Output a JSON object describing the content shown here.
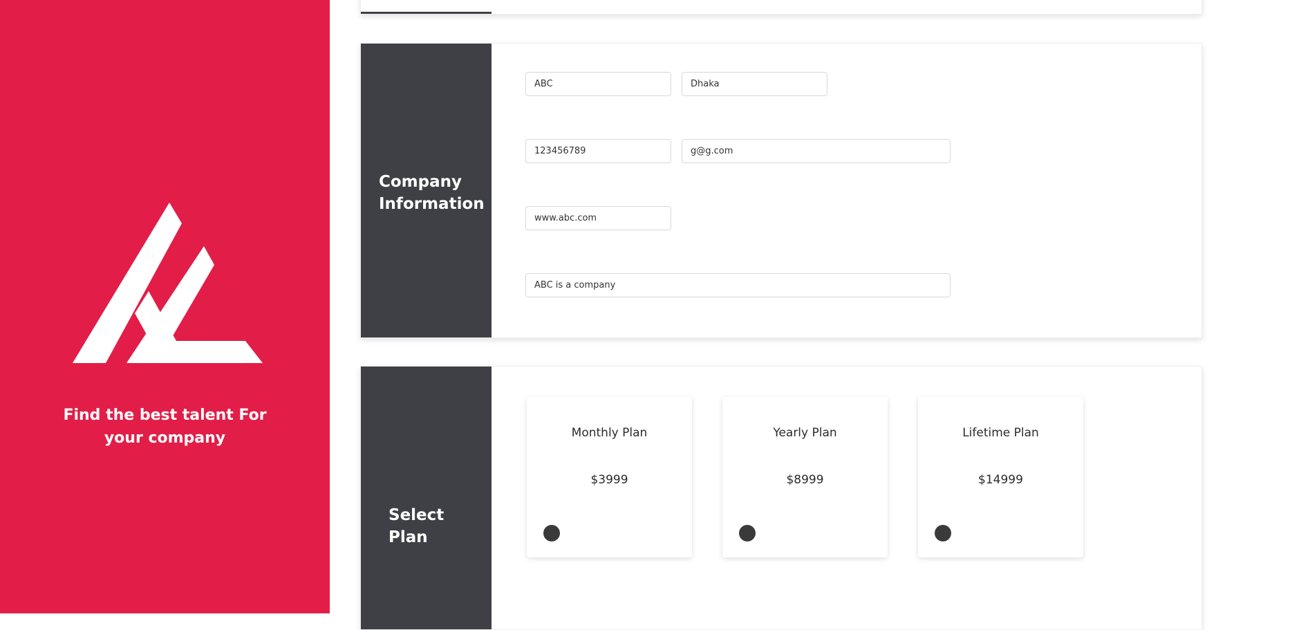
{
  "brand": {
    "tagline_line1": "Find the best talent For",
    "tagline_line2": "your company",
    "accent_color": "#e21e48",
    "dark_color": "#3f4045"
  },
  "company_section": {
    "title_line1": "Company",
    "title_line2": "Information",
    "fields": {
      "name": "ABC",
      "city": "Dhaka",
      "phone": "123456789",
      "email": "g@g.com",
      "website": "www.abc.com",
      "description": "ABC is a company"
    }
  },
  "plan_section": {
    "title_line1": "Select",
    "title_line2": "Plan",
    "plans": [
      {
        "name": "Monthly Plan",
        "price": "$3999"
      },
      {
        "name": "Yearly Plan",
        "price": "$8999"
      },
      {
        "name": "Lifetime Plan",
        "price": "$14999"
      }
    ]
  }
}
